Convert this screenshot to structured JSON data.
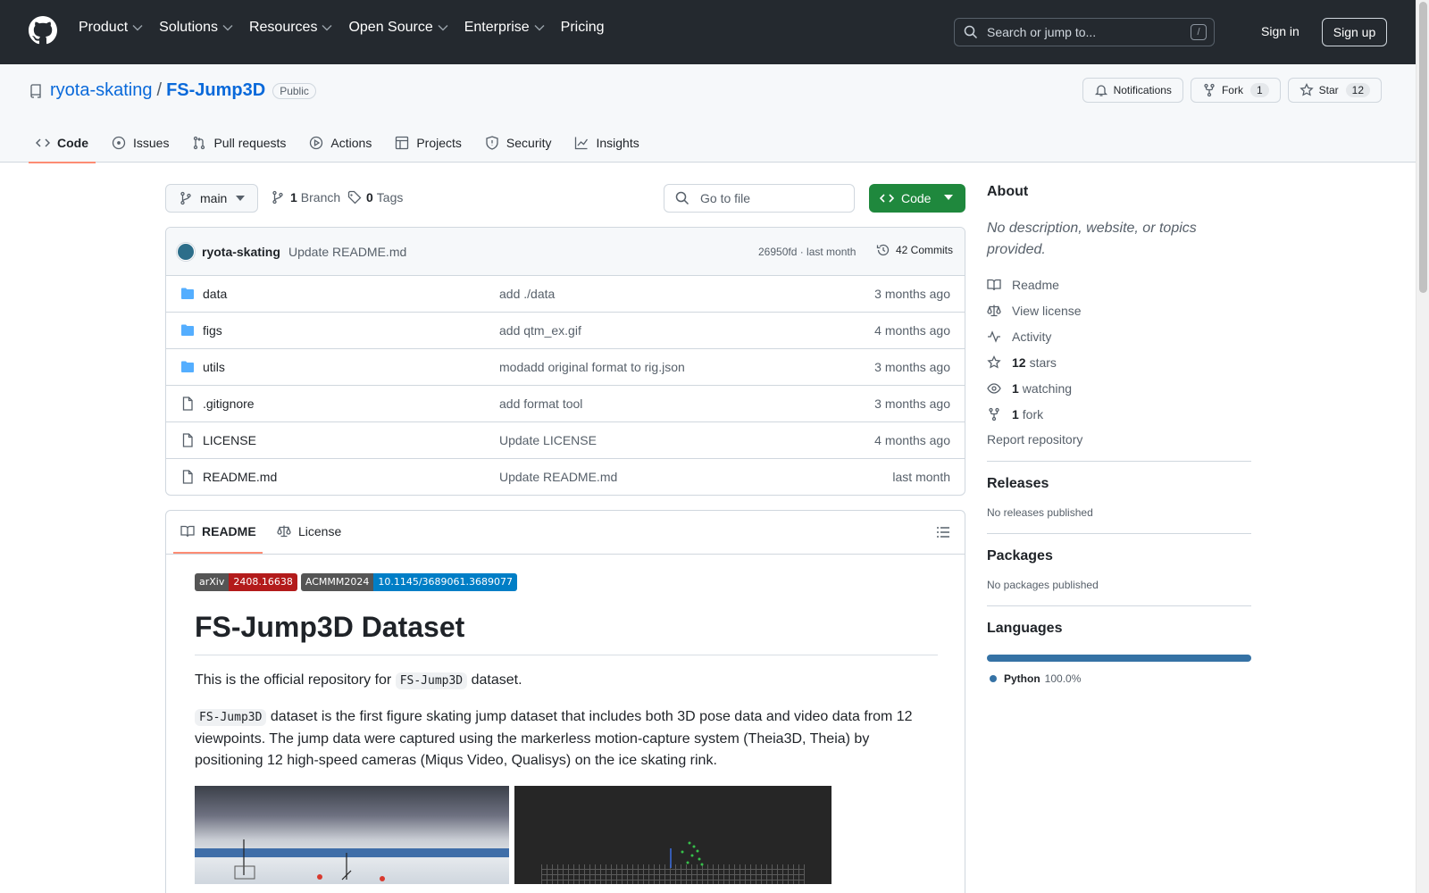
{
  "header": {
    "nav": [
      {
        "label": "Product",
        "dropdown": true
      },
      {
        "label": "Solutions",
        "dropdown": true
      },
      {
        "label": "Resources",
        "dropdown": true
      },
      {
        "label": "Open Source",
        "dropdown": true
      },
      {
        "label": "Enterprise",
        "dropdown": true
      },
      {
        "label": "Pricing",
        "dropdown": false
      }
    ],
    "search_placeholder": "Search or jump to...",
    "search_shortcut": "/",
    "sign_in": "Sign in",
    "sign_up": "Sign up"
  },
  "repo": {
    "owner": "ryota-skating",
    "separator": "/",
    "name": "FS-Jump3D",
    "visibility": "Public",
    "notifications_label": "Notifications",
    "fork_label": "Fork",
    "fork_count": "1",
    "star_label": "Star",
    "star_count": "12",
    "tabs": [
      {
        "label": "Code",
        "icon": "code-icon",
        "active": true
      },
      {
        "label": "Issues",
        "icon": "issue-icon",
        "active": false
      },
      {
        "label": "Pull requests",
        "icon": "pull-request-icon",
        "active": false
      },
      {
        "label": "Actions",
        "icon": "play-icon",
        "active": false
      },
      {
        "label": "Projects",
        "icon": "table-icon",
        "active": false
      },
      {
        "label": "Security",
        "icon": "shield-icon",
        "active": false
      },
      {
        "label": "Insights",
        "icon": "graph-icon",
        "active": false
      }
    ]
  },
  "file_nav": {
    "branch": "main",
    "branch_count": "1",
    "branch_word": "Branch",
    "tag_count": "0",
    "tag_word": "Tags",
    "goto_placeholder": "Go to file",
    "code_button": "Code"
  },
  "latest_commit": {
    "author": "ryota-skating",
    "message": "Update README.md",
    "sha_and_time": "26950fd · last month",
    "commits": "42 Commits"
  },
  "files": [
    {
      "type": "folder",
      "name": "data",
      "message": "add ./data",
      "date": "3 months ago"
    },
    {
      "type": "folder",
      "name": "figs",
      "message": "add qtm_ex.gif",
      "date": "4 months ago"
    },
    {
      "type": "folder",
      "name": "utils",
      "message": "modadd original format to rig.json",
      "date": "3 months ago"
    },
    {
      "type": "file",
      "name": ".gitignore",
      "message": "add format tool",
      "date": "3 months ago"
    },
    {
      "type": "file",
      "name": "LICENSE",
      "message": "Update LICENSE",
      "date": "4 months ago"
    },
    {
      "type": "file",
      "name": "README.md",
      "message": "Update README.md",
      "date": "last month"
    }
  ],
  "readme": {
    "tab_readme": "README",
    "tab_license": "License",
    "badges": [
      {
        "left": "arXiv",
        "right": "2408.16638",
        "color": "#b31b1b"
      },
      {
        "left": "ACMMM2024",
        "right": "10.1145/3689061.3689077",
        "color": "#007ec6"
      }
    ],
    "title": "FS-Jump3D Dataset",
    "p1_before": "This is the official repository for ",
    "p1_code": "FS-Jump3D",
    "p1_after": " dataset.",
    "p2_code": "FS-Jump3D",
    "p2_text": " dataset is the first figure skating jump dataset that includes both 3D pose data and video data from 12 viewpoints. The jump data were captured using the markerless motion-capture system (Theia3D, Theia) by positioning 12 high-speed cameras (Miqus Video, Qualisys) on the ice skating rink."
  },
  "sidebar": {
    "about_title": "About",
    "about_desc": "No description, website, or topics provided.",
    "links": [
      {
        "icon": "book-icon",
        "bold": "",
        "text": "Readme"
      },
      {
        "icon": "scale-icon",
        "bold": "",
        "text": "View license"
      },
      {
        "icon": "pulse-icon",
        "bold": "",
        "text": "Activity"
      },
      {
        "icon": "star-icon",
        "bold": "12",
        "text": "stars"
      },
      {
        "icon": "eye-icon",
        "bold": "1",
        "text": "watching"
      },
      {
        "icon": "fork-icon",
        "bold": "1",
        "text": "fork"
      }
    ],
    "report": "Report repository",
    "releases_title": "Releases",
    "releases_note": "No releases published",
    "packages_title": "Packages",
    "packages_note": "No packages published",
    "languages_title": "Languages",
    "language": {
      "name": "Python",
      "percent": "100.0%",
      "fraction": 1.0,
      "color": "#3572a5"
    }
  }
}
